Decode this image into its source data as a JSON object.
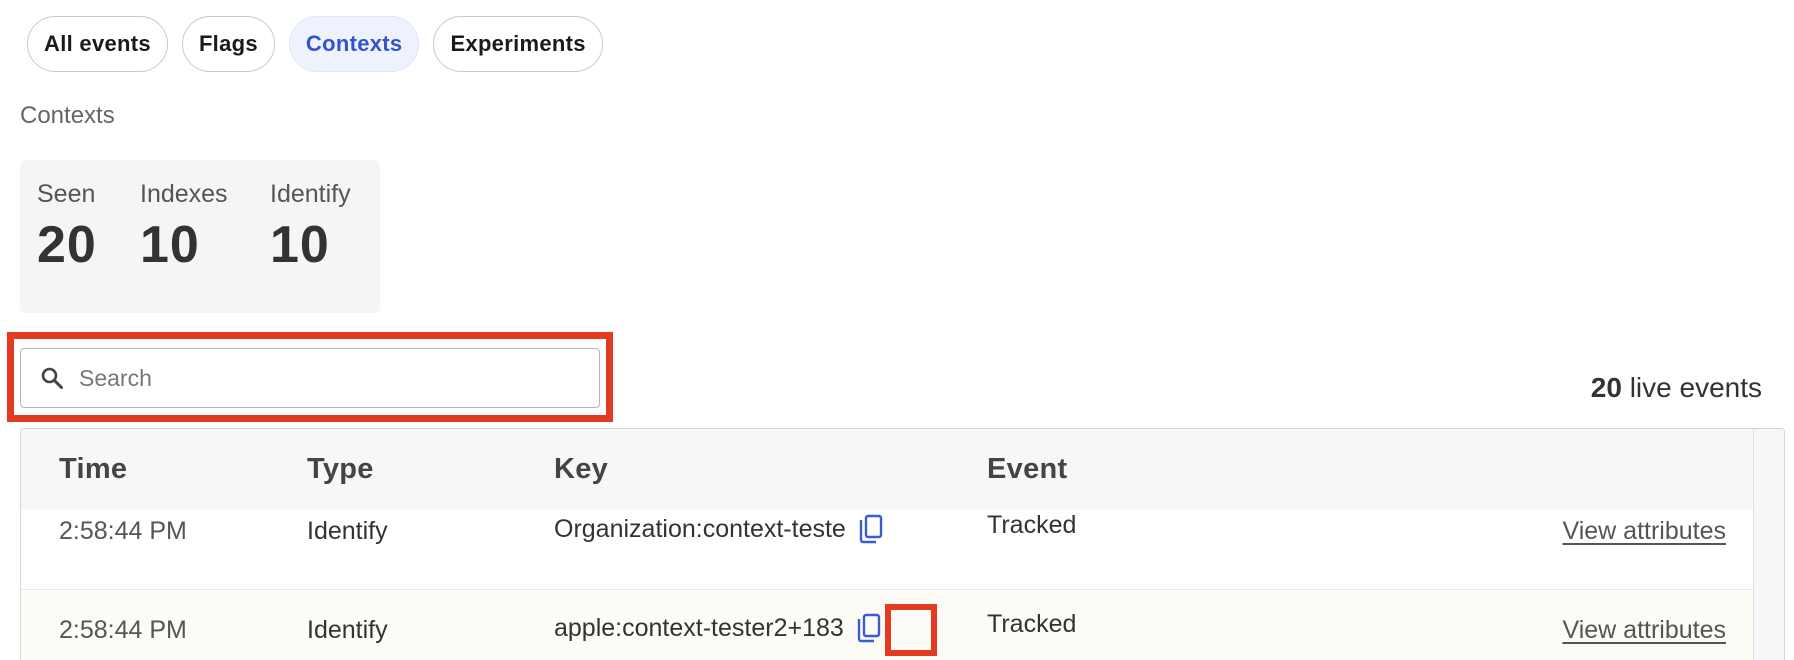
{
  "filters": {
    "tabs": [
      {
        "label": "All events",
        "active": false
      },
      {
        "label": "Flags",
        "active": false
      },
      {
        "label": "Contexts",
        "active": true
      },
      {
        "label": "Experiments",
        "active": false
      }
    ]
  },
  "section": {
    "title": "Contexts"
  },
  "stats": [
    {
      "label": "Seen",
      "value": "20"
    },
    {
      "label": "Indexes",
      "value": "10"
    },
    {
      "label": "Identify",
      "value": "10"
    }
  ],
  "search": {
    "placeholder": "Search",
    "value": ""
  },
  "live": {
    "count": "20",
    "label": "live events"
  },
  "table": {
    "columns": [
      "Time",
      "Type",
      "Key",
      "Event"
    ],
    "rows": [
      {
        "time": "2:58:44 PM",
        "type": "Identify",
        "key": "Organization:context-teste",
        "event": "Tracked",
        "action": "View attributes"
      },
      {
        "time": "2:58:44 PM",
        "type": "Identify",
        "key": "apple:context-tester2+183",
        "event": "Tracked",
        "action": "View attributes"
      }
    ]
  },
  "colors": {
    "accent": "#3654c9",
    "active_pill_bg": "#eef2fd",
    "highlight": "#e23b22",
    "copy_icon": "#3d5ccc"
  }
}
